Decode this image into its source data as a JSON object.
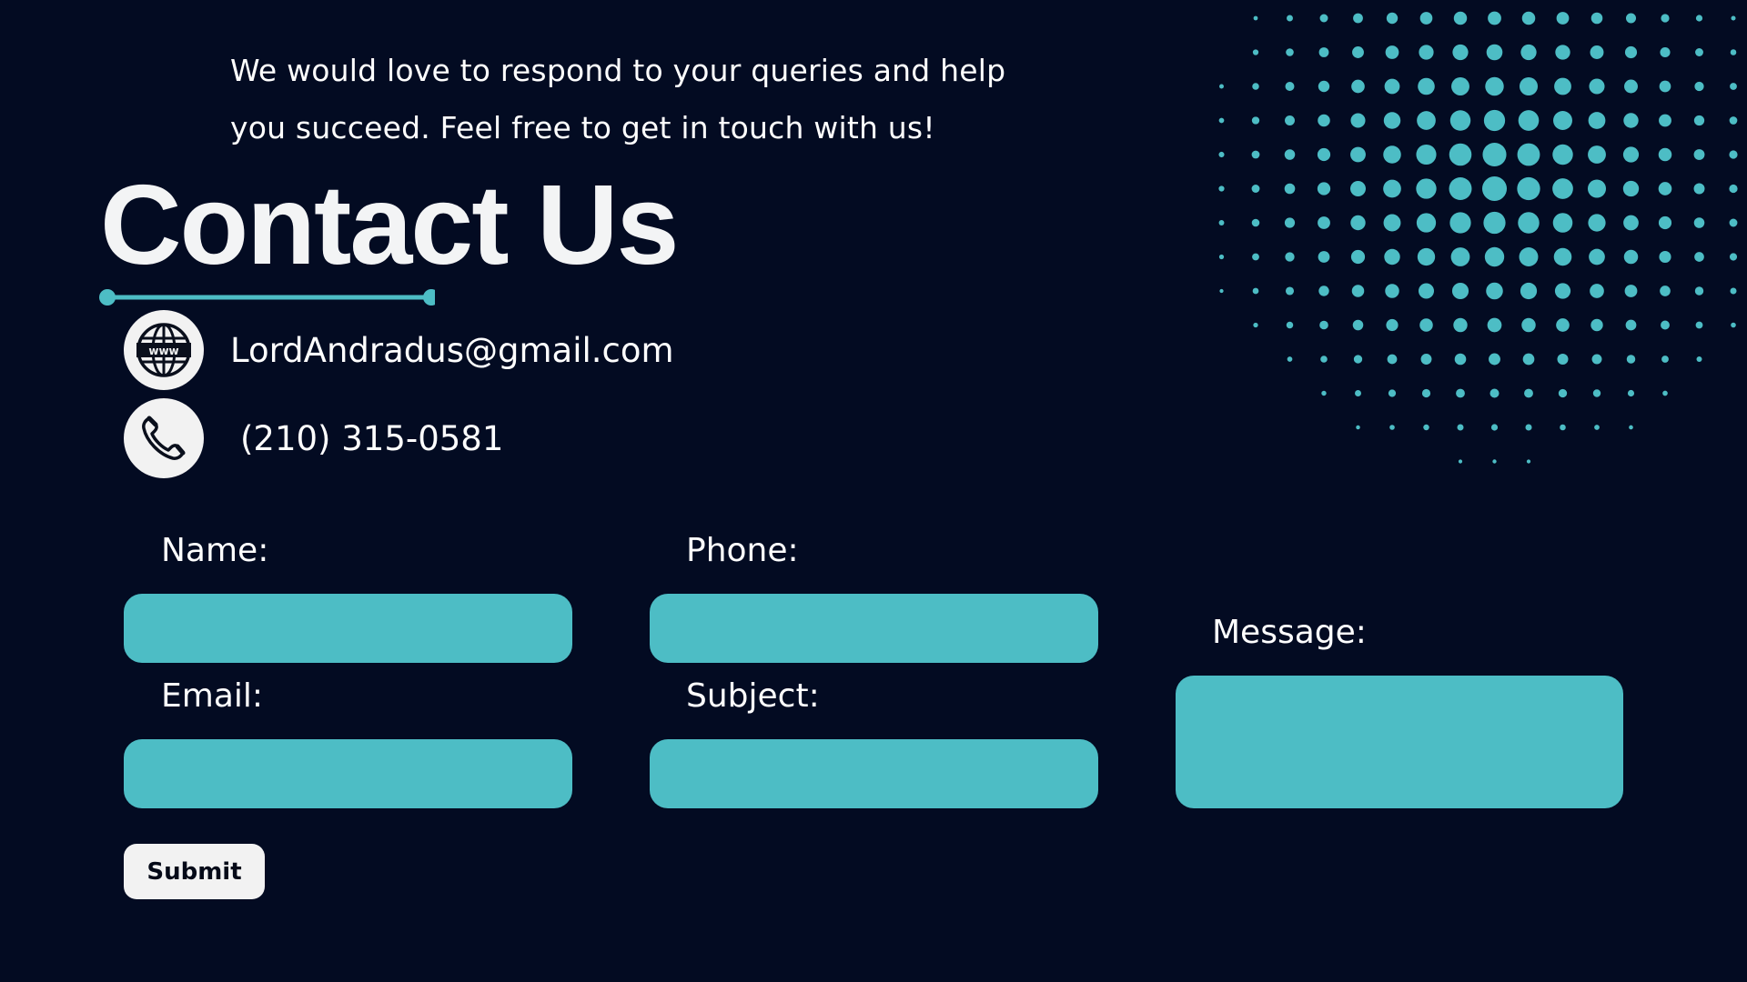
{
  "intro": {
    "line1": "We would love to respond to your queries and help",
    "line2": "you succeed. Feel free to get in touch with us!"
  },
  "heading": "Contact Us",
  "contact": {
    "email_text": "LordAndradus@gmail.com",
    "phone_text": "(210) 315-0581",
    "email_icon": "www-globe-icon",
    "phone_icon": "telephone-icon"
  },
  "form": {
    "name_label": "Name:",
    "phone_label": "Phone:",
    "email_label": "Email:",
    "subject_label": "Subject:",
    "message_label": "Message:",
    "submit_label": "Submit"
  },
  "colors": {
    "background": "#030b22",
    "accent": "#4dbdc5",
    "text": "#ffffff",
    "button": "#f2f2f2"
  }
}
